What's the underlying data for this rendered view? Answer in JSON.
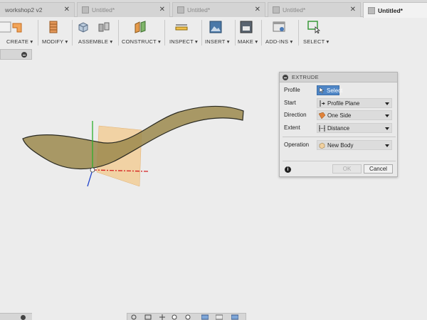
{
  "tabs": [
    {
      "label": "workshop2 v2",
      "active": false
    },
    {
      "label": "Untitled*",
      "active": false
    },
    {
      "label": "Untitled*",
      "active": false
    },
    {
      "label": "Untitled*",
      "active": false
    },
    {
      "label": "Untitled*",
      "active": true
    }
  ],
  "toolbar": {
    "create": "CREATE ▾",
    "modify": "MODIFY ▾",
    "assemble": "ASSEMBLE ▾",
    "construct": "CONSTRUCT ▾",
    "inspect": "INSPECT ▾",
    "insert": "INSERT ▾",
    "make": "MAKE ▾",
    "addins": "ADD-INS ▾",
    "select": "SELECT ▾"
  },
  "extrude": {
    "title": "EXTRUDE",
    "profile_label": "Profile",
    "profile_value": "Select",
    "start_label": "Start",
    "start_value": "Profile Plane",
    "direction_label": "Direction",
    "direction_value": "One Side",
    "extent_label": "Extent",
    "extent_value": "Distance",
    "operation_label": "Operation",
    "operation_value": "New Body",
    "ok": "OK",
    "cancel": "Cancel",
    "info": "i"
  },
  "colors": {
    "accent": "#4f86c6",
    "sketch_fill": "#9c8a4e",
    "plane_fill": "#f3c98c",
    "axis_x": "#d62020",
    "axis_y": "#2cae2c",
    "axis_z": "#2244cc"
  }
}
